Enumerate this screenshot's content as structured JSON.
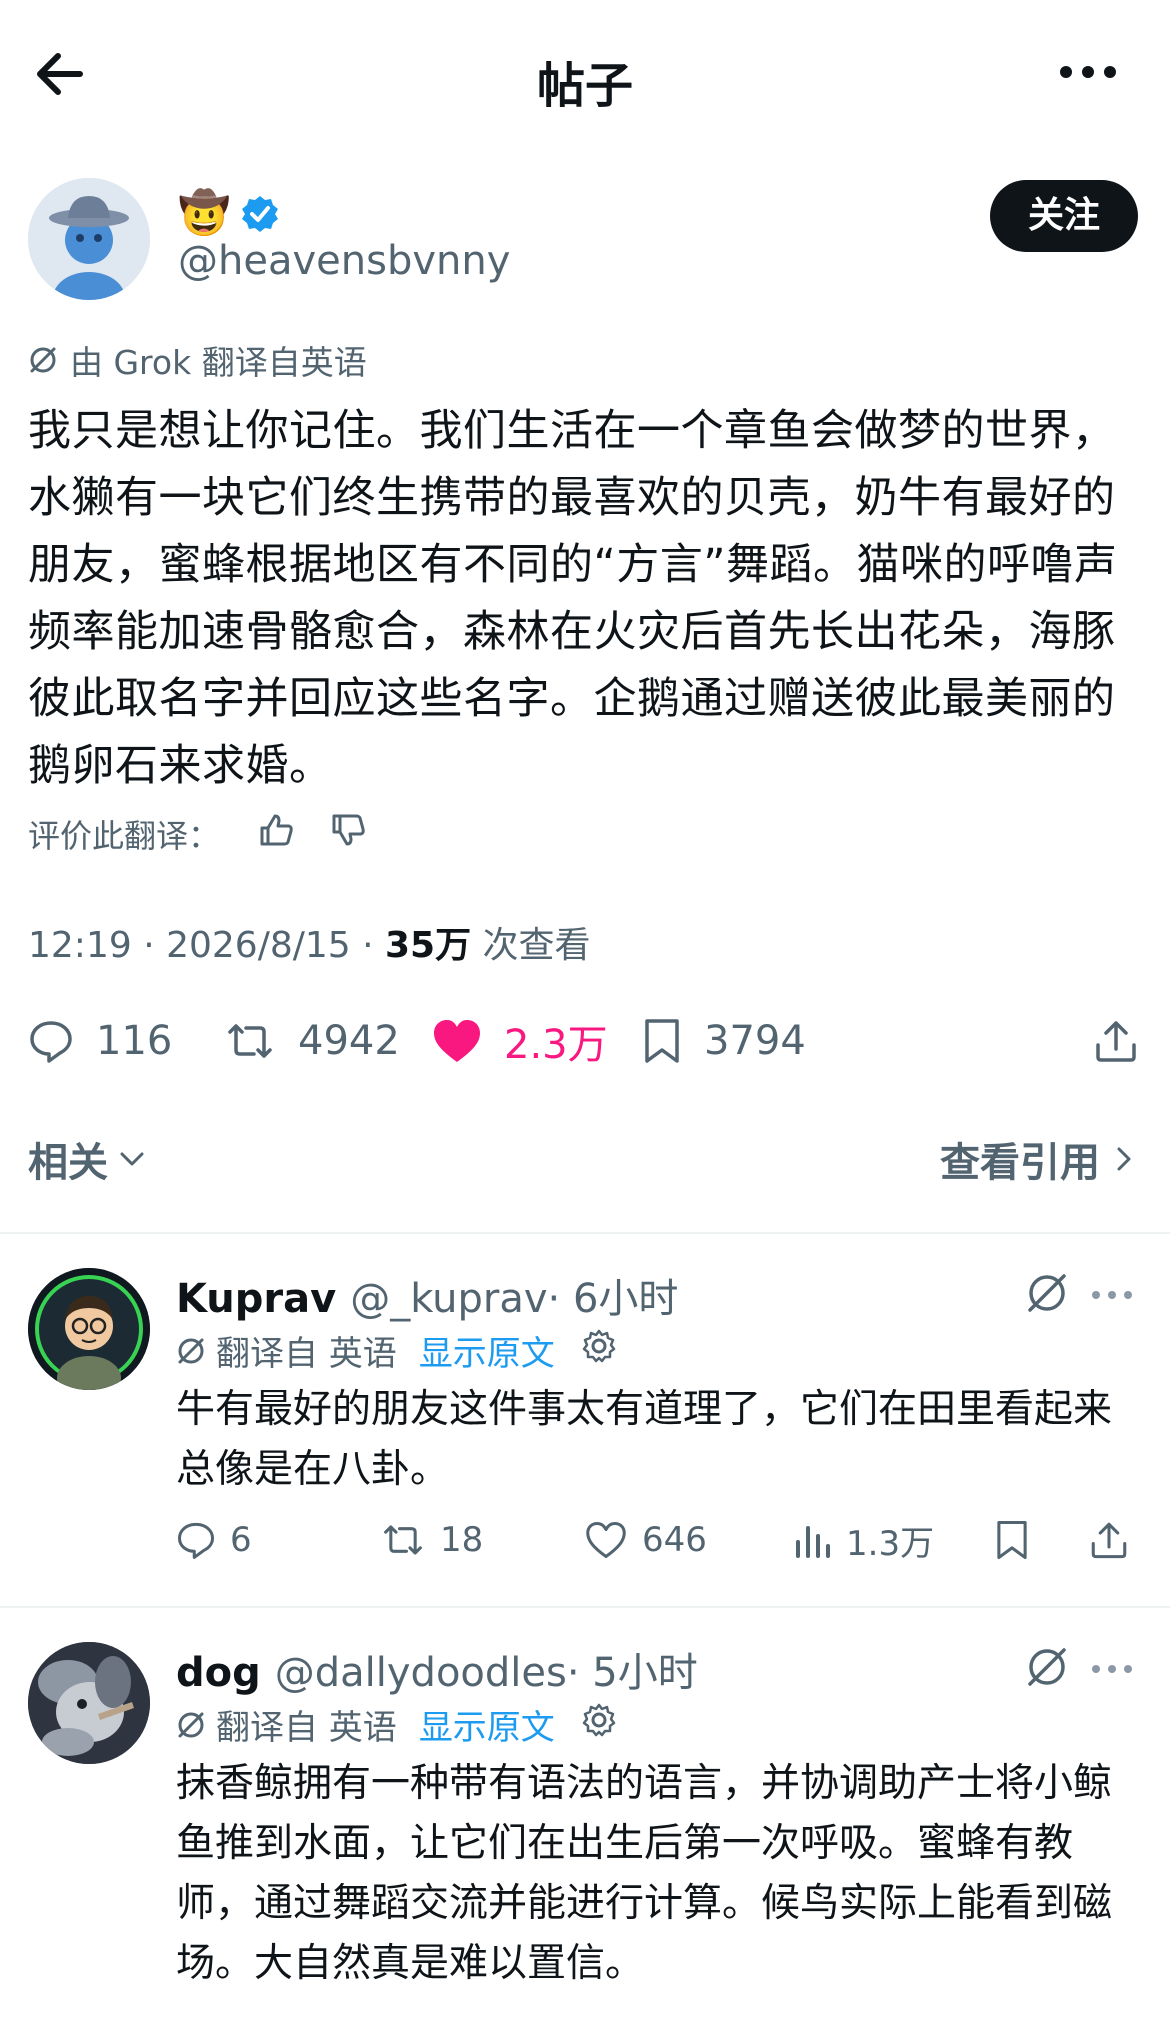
{
  "header": {
    "title": "帖子"
  },
  "post": {
    "author_emoji": "🤠",
    "handle": "@heavensbvnny",
    "follow_label": "关注",
    "translation_note": "由 Grok 翻译自英语",
    "text": "我只是想让你记住。我们生活在一个章鱼会做梦的世界，水獭有一块它们终生携带的最喜欢的贝壳，奶牛有最好的朋友，蜜蜂根据地区有不同的“方言”舞蹈。猫咪的呼噜声频率能加速骨骼愈合，森林在火灾后首先长出花朵，海豚彼此取名字并回应这些名字。企鹅通过赠送彼此最美丽的鹅卵石来求婚。",
    "rate_label": "评价此翻译：",
    "time": "12:19 · 2026/8/15 · ",
    "views_count": "35万",
    "views_label": " 次查看",
    "stats": {
      "replies": "116",
      "reposts": "4942",
      "likes": "2.3万",
      "bookmarks": "3794"
    },
    "colors": {
      "like": "#f91880",
      "verified": "#1d9bf0"
    }
  },
  "related": {
    "label": "相关",
    "quotes_label": "查看引用"
  },
  "replies": [
    {
      "name": "Kuprav",
      "handle": "@_kuprav",
      "time": " · 6小时",
      "translated_from": "翻译自 英语",
      "show_original": "显示原文",
      "text": "牛有最好的朋友这件事太有道理了，它们在田里看起来总像是在八卦。",
      "stats": {
        "replies": "6",
        "reposts": "18",
        "likes": "646",
        "views": "1.3万"
      }
    },
    {
      "name": "dog",
      "handle": "@dallydoodles",
      "time": " · 5小时",
      "translated_from": "翻译自 英语",
      "show_original": "显示原文",
      "text": "抹香鲸拥有一种带有语法的语言，并协调助产士将小鲸鱼推到水面，让它们在出生后第一次呼吸。蜜蜂有教师，通过舞蹈交流并能进行计算。候鸟实际上能看到磁场。大自然真是难以置信。"
    }
  ]
}
